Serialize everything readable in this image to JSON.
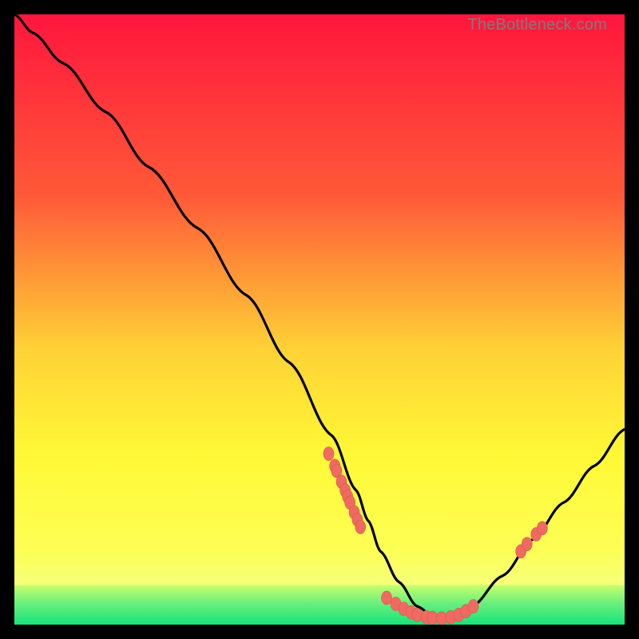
{
  "watermark": "TheBottleneck.com",
  "colors": {
    "frame": "#000000",
    "curve": "#000000",
    "marker_fill": "#ef6a61",
    "marker_stroke": "#d9564f",
    "grad_top": "#ff163d",
    "grad_mid1": "#ff7d3a",
    "grad_mid2": "#ffd236",
    "grad_mid3": "#fff835",
    "grad_bottom_yellow": "#f6ff7a",
    "grad_green": "#17e37a"
  },
  "chart_data": {
    "type": "line",
    "title": "",
    "xlabel": "",
    "ylabel": "",
    "xlim": [
      0,
      100
    ],
    "ylim": [
      0,
      100
    ],
    "curve": {
      "x": [
        0,
        3,
        8,
        15,
        22,
        30,
        38,
        45,
        52,
        56,
        58,
        60,
        63,
        66,
        69,
        72,
        75,
        80,
        85,
        90,
        95,
        100
      ],
      "y": [
        100,
        97,
        92,
        84,
        75,
        65,
        54,
        43,
        31,
        22,
        17,
        12,
        7,
        3,
        1,
        1,
        3,
        8,
        14,
        20,
        26,
        32
      ]
    },
    "series": [
      {
        "name": "left-descent-cluster",
        "x": [
          51.5,
          52.5,
          52.8,
          53.6,
          54.2,
          54.6,
          55.0,
          55.7,
          56.2,
          56.7
        ],
        "y": [
          28.0,
          26.0,
          25.2,
          23.4,
          22.0,
          21.0,
          20.0,
          18.4,
          17.2,
          16.0
        ]
      },
      {
        "name": "bottom-cluster",
        "x": [
          61.0,
          62.5,
          63.8,
          65.0,
          66.0,
          67.5,
          68.5,
          70.0,
          71.5,
          72.8,
          74.0,
          75.2
        ],
        "y": [
          4.4,
          3.4,
          2.6,
          2.0,
          1.6,
          1.2,
          1.1,
          1.0,
          1.2,
          1.6,
          2.2,
          3.0
        ]
      },
      {
        "name": "right-ascent-cluster",
        "x": [
          83.0,
          84.0,
          85.5,
          86.5
        ],
        "y": [
          12.0,
          13.2,
          14.8,
          15.8
        ]
      }
    ]
  }
}
